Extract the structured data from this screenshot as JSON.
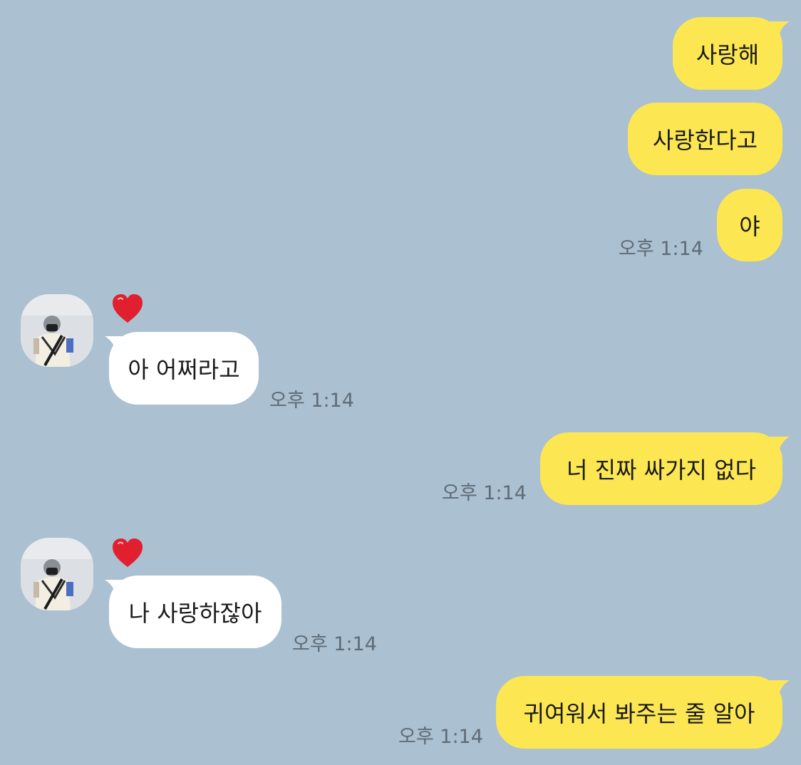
{
  "messages": [
    {
      "from": "me",
      "text": "사랑해"
    },
    {
      "from": "me",
      "text": "사랑한다고"
    },
    {
      "from": "me",
      "text": "야",
      "time": "오후 1:14"
    },
    {
      "from": "them",
      "text": "아 어쩌라고",
      "time": "오후 1:14",
      "reaction": "heart-icon"
    },
    {
      "from": "me",
      "text": "너 진짜 싸가지 없다",
      "time": "오후 1:14"
    },
    {
      "from": "them",
      "text": "나 사랑하잖아",
      "time": "오후 1:14",
      "reaction": "heart-icon"
    },
    {
      "from": "me",
      "text": "귀여워서 봐주는 줄 알아",
      "time": "오후 1:14"
    }
  ],
  "colors": {
    "background": "#abc0d1",
    "my_bubble": "#fce753",
    "their_bubble": "#ffffff",
    "timestamp": "#5f6b76",
    "reaction_heart": "#e0202e"
  }
}
